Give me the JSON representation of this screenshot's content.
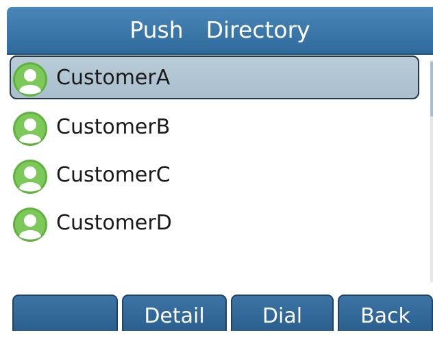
{
  "header": {
    "title": "Push  Directory"
  },
  "contacts": [
    {
      "name": "CustomerA",
      "selected": true,
      "icon": "contact-avatar-icon"
    },
    {
      "name": "CustomerB",
      "selected": false,
      "icon": "contact-avatar-icon"
    },
    {
      "name": "CustomerC",
      "selected": false,
      "icon": "contact-avatar-icon"
    },
    {
      "name": "CustomerD",
      "selected": false,
      "icon": "contact-avatar-icon"
    }
  ],
  "softkeys": [
    {
      "label": ""
    },
    {
      "label": "Detail"
    },
    {
      "label": "Dial"
    },
    {
      "label": "Back"
    }
  ],
  "colors": {
    "title_bar": "#3a78ab",
    "selection": "#b3c7d4",
    "avatar": "#6fbf4a"
  }
}
